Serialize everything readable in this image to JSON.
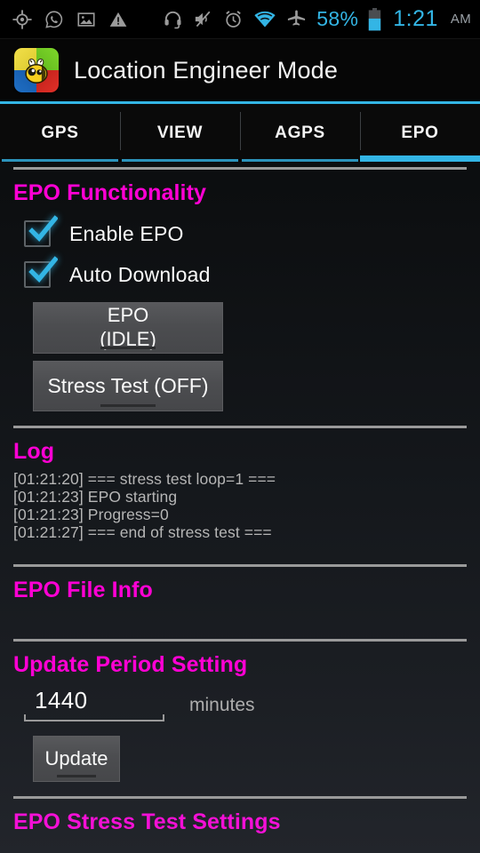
{
  "status_bar": {
    "left_icons": [
      "location-icon",
      "whatsapp-icon",
      "image-icon",
      "warning-icon"
    ],
    "right_icons": [
      "headset-icon",
      "mute-icon",
      "alarm-icon",
      "wifi-icon",
      "airplane-icon"
    ],
    "battery_percent": "58%",
    "time": "1:21",
    "meridiem": "AM",
    "accent_color": "#33b5e5"
  },
  "action_bar": {
    "title": "Location Engineer Mode",
    "icon": "bee-app-icon"
  },
  "tabs": [
    {
      "label": "GPS",
      "active": false
    },
    {
      "label": "VIEW",
      "active": false
    },
    {
      "label": "AGPS",
      "active": false
    },
    {
      "label": "EPO",
      "active": true
    }
  ],
  "sections": {
    "functionality": {
      "title": "EPO Functionality",
      "enable_epo_label": "Enable EPO",
      "enable_epo_checked": true,
      "auto_download_label": "Auto Download",
      "auto_download_checked": true,
      "epo_button_line1": "EPO",
      "epo_button_line2": "(IDLE)",
      "stress_button_label": "Stress Test (OFF)"
    },
    "log": {
      "title": "Log",
      "lines": [
        "[01:21:20] === stress test loop=1 ===",
        "[01:21:23] EPO starting",
        "[01:21:23] Progress=0",
        "[01:21:27] === end of stress test ==="
      ]
    },
    "file_info": {
      "title": "EPO File Info",
      "body": ""
    },
    "update_period": {
      "title": "Update Period Setting",
      "value": "1440",
      "unit_label": "minutes",
      "update_button_label": "Update"
    },
    "stress_settings": {
      "title": "EPO Stress Test Settings"
    }
  },
  "colors": {
    "section_heading": "#ff00d4",
    "accent": "#33b5e5",
    "divider": "#9a9a9a"
  }
}
